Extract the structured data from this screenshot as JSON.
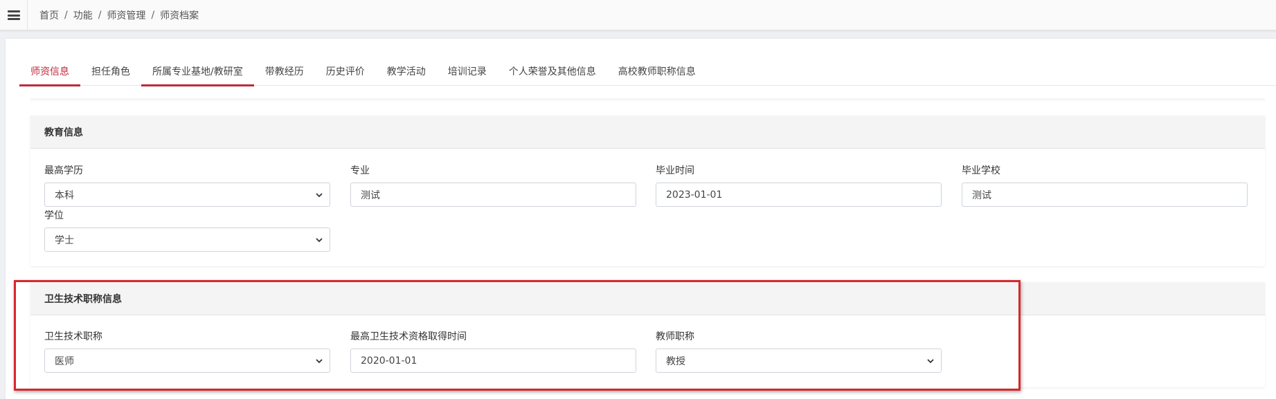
{
  "breadcrumb": [
    "首页",
    "功能",
    "师资管理",
    "师资档案"
  ],
  "breadcrumb_separator": "/",
  "tabs": [
    {
      "label": "师资信息"
    },
    {
      "label": "担任角色"
    },
    {
      "label": "所属专业基地/教研室"
    },
    {
      "label": "带教经历"
    },
    {
      "label": "历史评价"
    },
    {
      "label": "教学活动"
    },
    {
      "label": "培训记录"
    },
    {
      "label": "个人荣誉及其他信息"
    },
    {
      "label": "高校教师职称信息"
    }
  ],
  "education": {
    "title": "教育信息",
    "fields": [
      {
        "label": "最高学历",
        "value": "本科",
        "type": "select"
      },
      {
        "label": "专业",
        "value": "测试",
        "type": "text"
      },
      {
        "label": "毕业时间",
        "value": "2023-01-01",
        "type": "date"
      },
      {
        "label": "毕业学校",
        "value": "测试",
        "type": "text"
      },
      {
        "label": "学位",
        "value": "学士",
        "type": "select"
      }
    ]
  },
  "health_title": {
    "title": "卫生技术职称信息",
    "fields": [
      {
        "label": "卫生技术职称",
        "value": "医师",
        "type": "select"
      },
      {
        "label": "最高卫生技术资格取得时间",
        "value": "2020-01-01",
        "type": "date"
      },
      {
        "label": "教师职称",
        "value": "教授",
        "type": "select"
      }
    ]
  },
  "colors": {
    "accent": "#c0283a",
    "highlight": "#d9262b"
  }
}
